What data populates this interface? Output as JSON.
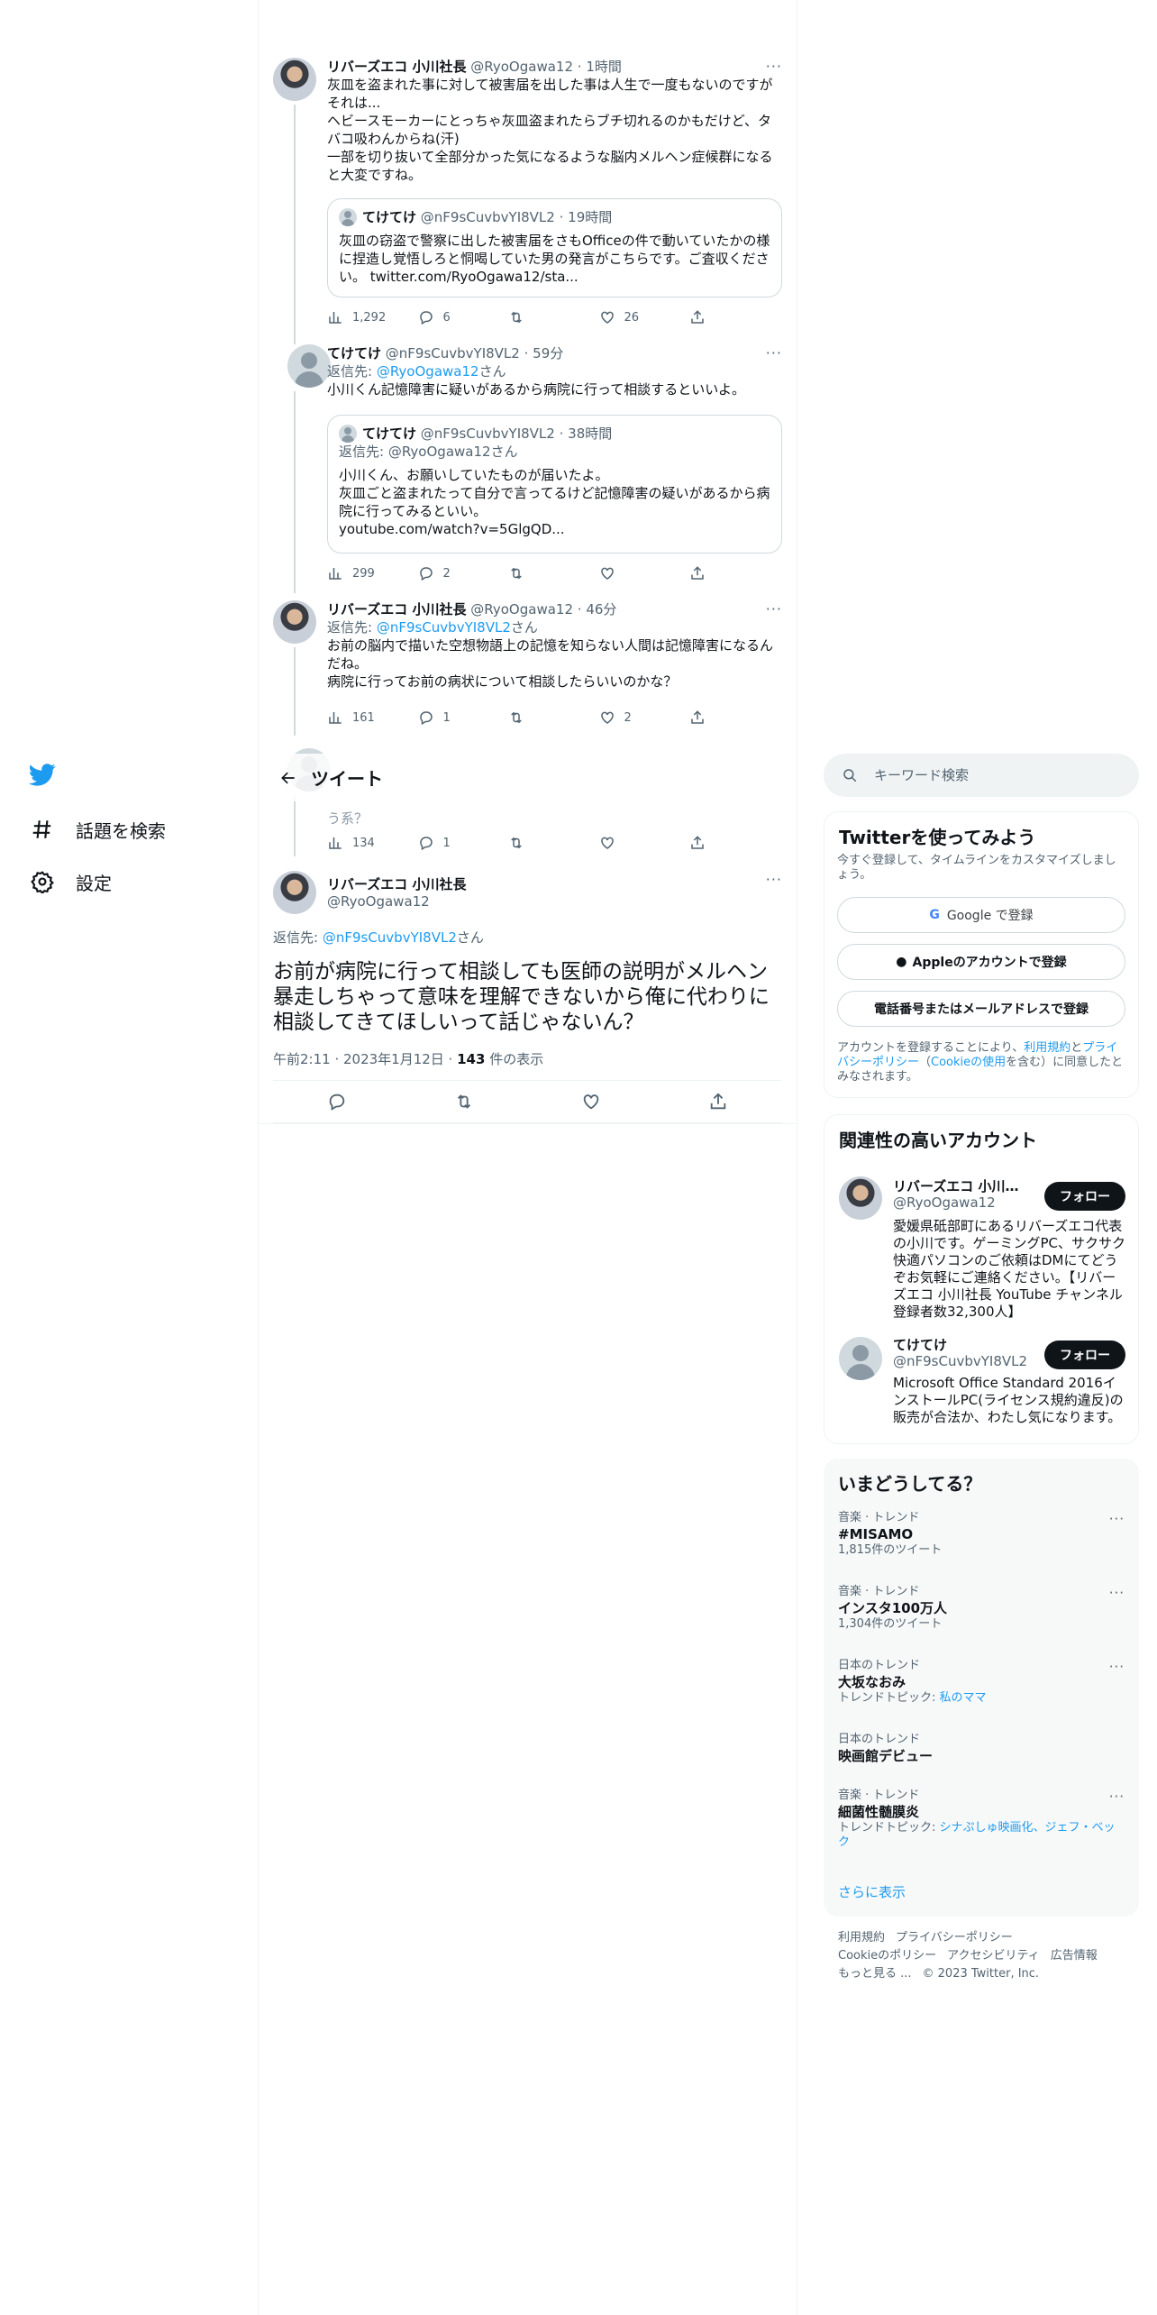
{
  "colors": {
    "accent": "#1d9bf0",
    "text": "#0f1419",
    "muted": "#536471",
    "border": "#eff3f4"
  },
  "nav": {
    "explore_label": "話題を検索",
    "settings_label": "設定"
  },
  "thread": [
    {
      "name": "リバーズエコ 小川社長",
      "handle": "@RyoOgawa12",
      "time": "1時間",
      "text": "灰皿を盗まれた事に対して被害届を出した事は人生で一度もないのですがそれは...\nヘビースモーカーにとっちゃ灰皿盗まれたらブチ切れるのかもだけど、タバコ吸わんからね(汗)\n一部を切り抜いて全部分かった気になるような脳内メルヘン症候群になると大変ですね。",
      "quote": {
        "name": "てけてけ",
        "handle": "@nF9sCuvbvYI8VL2",
        "time": "19時間",
        "text": "灰皿の窃盗で警察に出した被害届をさもOfficeの件で動いていたかの様に捏造し覚悟しろと恫喝していた男の発言がこちらです。ご査収ください。 twitter.com/RyoOgawa12/sta..."
      },
      "stats": {
        "views": "1,292",
        "replies": "6",
        "retweets": "",
        "likes": "26"
      }
    },
    {
      "name": "てけてけ",
      "handle": "@nF9sCuvbvYI8VL2",
      "time": "59分",
      "reply_prefix": "返信先: ",
      "reply_to": "@RyoOgawa12",
      "reply_suffix": "さん",
      "text": "小川くん記憶障害に疑いがあるから病院に行って相談するといいよ。",
      "quote": {
        "name": "てけてけ",
        "handle": "@nF9sCuvbvYI8VL2",
        "time": "38時間",
        "reply_prefix": "返信先: ",
        "reply_to": "@RyoOgawa12",
        "reply_suffix": "さん",
        "text": "小川くん、お願いしていたものが届いたよ。\n灰皿ごと盗まれたって自分で言ってるけど記憶障害の疑いがあるから病院に行ってみるといい。\nyoutube.com/watch?v=5GlgQD..."
      },
      "stats": {
        "views": "299",
        "replies": "2",
        "retweets": "",
        "likes": ""
      }
    },
    {
      "name": "リバーズエコ 小川社長",
      "handle": "@RyoOgawa12",
      "time": "46分",
      "reply_prefix": "返信先: ",
      "reply_to": "@nF9sCuvbvYI8VL2",
      "reply_suffix": "さん",
      "text": "お前の脳内で描いた空想物語上の記憶を知らない人間は記憶障害になるんだね。\n病院に行ってお前の病状について相談したらいいのかな？",
      "stats": {
        "views": "161",
        "replies": "1",
        "retweets": "",
        "likes": "2"
      }
    },
    {
      "text_tail": "う系？",
      "stats": {
        "views": "134",
        "replies": "1",
        "retweets": "",
        "likes": ""
      }
    }
  ],
  "header": {
    "title": "ツイート"
  },
  "focal": {
    "name": "リバーズエコ 小川社長",
    "handle": "@RyoOgawa12",
    "reply_prefix": "返信先: ",
    "reply_to": "@nF9sCuvbvYI8VL2",
    "reply_suffix": "さん",
    "text": "お前が病院に行って相談しても医師の説明がメルヘン暴走しちゃって意味を理解できないから俺に代わりに相談してきてほしいって話じゃないん？",
    "time": "午前2:11 · 2023年1月12日 · ",
    "views": "143",
    "views_label": " 件の表示"
  },
  "search": {
    "placeholder": "キーワード検索"
  },
  "signup": {
    "title": "Twitterを使ってみよう",
    "subtitle": "今すぐ登録して、タイムラインをカスタマイズしましょう。",
    "google_label": "Google で登録",
    "apple_label": "Appleのアカウントで登録",
    "phone_label": "電話番号またはメールアドレスで登録",
    "legal_prefix": "アカウントを登録することにより、",
    "legal_terms": "利用規約",
    "legal_and": "と",
    "legal_privacy": "プライバシーポリシー",
    "legal_cookie_open": "（",
    "legal_cookie": "Cookieの使用",
    "legal_suffix": "を含む）に同意したとみなされます。"
  },
  "who_to_follow": {
    "title": "関連性の高いアカウント",
    "follow_label": "フォロー",
    "accounts": [
      {
        "name": "リバーズエコ 小川社長",
        "handle": "@RyoOgawa12",
        "bio": "愛媛県砥部町にあるリバーズエコ代表の小川です。ゲーミングPC、サクサク快適パソコンのご依頼はDMにてどうぞお気軽にご連絡ください。【リバーズエコ 小川社長 YouTube チャンネル登録者数32,300人】"
      },
      {
        "name": "てけてけ",
        "handle": "@nF9sCuvbvYI8VL2",
        "bio": "Microsoft Office Standard 2016インストールPC(ライセンス規約違反)の販売が合法か、わたし気になります。"
      }
    ]
  },
  "trends": {
    "title": "いまどうしてる？",
    "items": [
      {
        "context": "音楽 · トレンド",
        "name": "#MISAMO",
        "sub": "1,815件のツイート"
      },
      {
        "context": "音楽 · トレンド",
        "name": "インスタ100万人",
        "sub": "1,304件のツイート"
      },
      {
        "context": "日本のトレンド",
        "name": "大坂なおみ",
        "sub_prefix": "トレンドトピック: ",
        "sub_link": "私のママ"
      },
      {
        "context": "日本のトレンド",
        "name": "映画館デビュー"
      },
      {
        "context": "音楽 · トレンド",
        "name": "細菌性髄膜炎",
        "sub_prefix": "トレンドトピック: ",
        "sub_link": "シナぷしゅ映画化、ジェフ・ベック"
      }
    ],
    "show_more": "さらに表示"
  },
  "footer": {
    "terms": "利用規約",
    "privacy": "プライバシーポリシー",
    "cookie": "Cookieのポリシー",
    "accessibility": "アクセシビリティ",
    "ads": "広告情報",
    "more": "もっと見る ...",
    "copyright": "© 2023 Twitter, Inc."
  }
}
